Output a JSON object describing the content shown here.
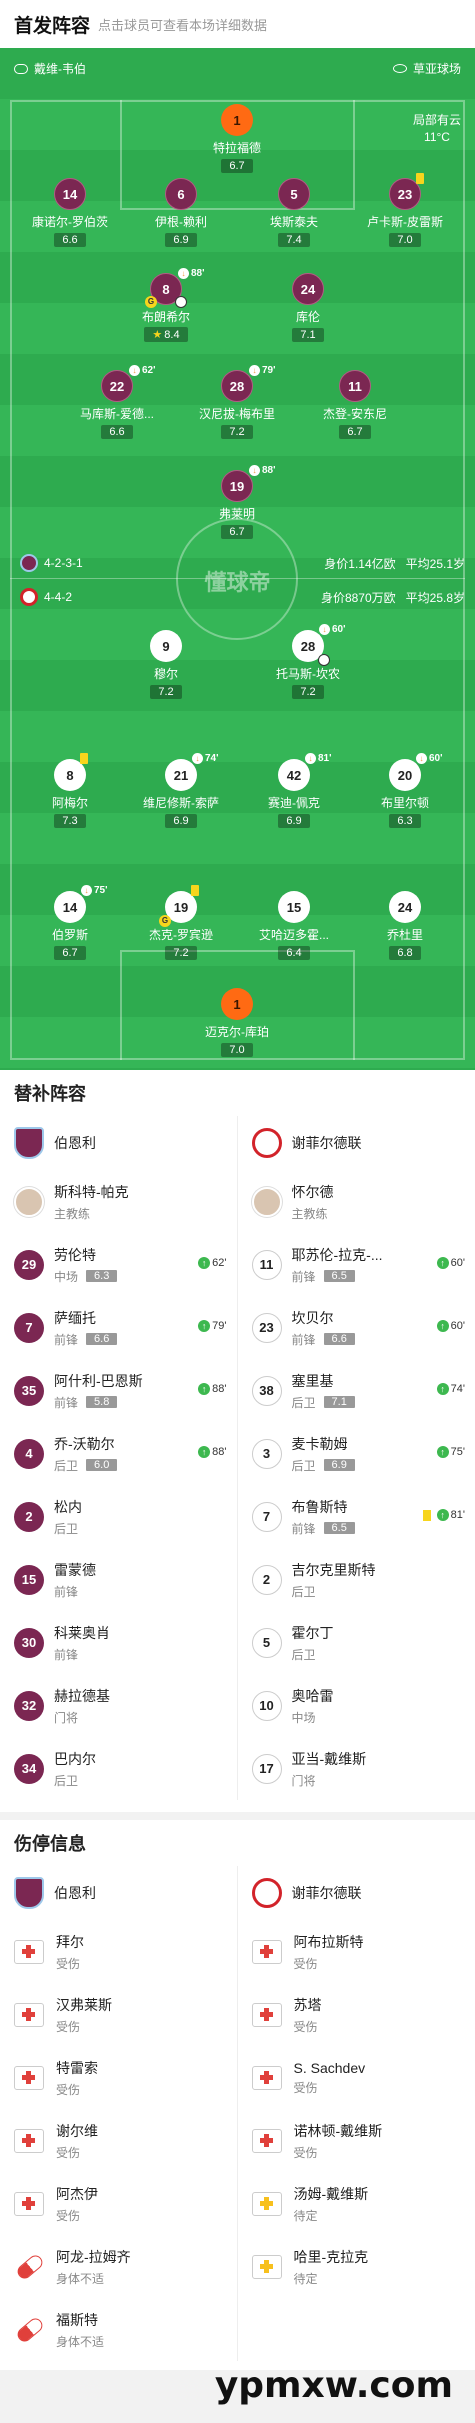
{
  "header": {
    "title": "首发阵容",
    "subtitle": "点击球员可查看本场详细数据"
  },
  "pitch": {
    "venue_left": "戴维-韦伯",
    "venue_right": "草亚球场",
    "weather": "局部有云",
    "temp": "11°C",
    "watermark": "懂球帝",
    "home_formation": "4-2-3-1",
    "home_value": "身价1.14亿欧",
    "home_age": "平均25.1岁",
    "away_formation": "4-4-2",
    "away_value": "身价8870万欧",
    "away_age": "平均25.8岁",
    "home_players": [
      {
        "num": "1",
        "name": "特拉福德",
        "rating": "6.7"
      },
      {
        "num": "14",
        "name": "康诺尔-罗伯茨",
        "rating": "6.6"
      },
      {
        "num": "6",
        "name": "伊根-赖利",
        "rating": "6.9"
      },
      {
        "num": "5",
        "name": "埃斯泰夫",
        "rating": "7.4"
      },
      {
        "num": "23",
        "name": "卢卡斯-皮雷斯",
        "rating": "7.0"
      },
      {
        "num": "8",
        "name": "布朗希尔",
        "rating": "8.4",
        "sub": "88'"
      },
      {
        "num": "24",
        "name": "库伦",
        "rating": "7.1"
      },
      {
        "num": "22",
        "name": "马库斯-爱德...",
        "rating": "6.6",
        "sub": "62'"
      },
      {
        "num": "28",
        "name": "汉尼拔-梅布里",
        "rating": "7.2",
        "sub": "79'"
      },
      {
        "num": "11",
        "name": "杰登-安东尼",
        "rating": "6.7"
      },
      {
        "num": "19",
        "name": "弗莱明",
        "rating": "6.7",
        "sub": "88'"
      }
    ],
    "away_players": [
      {
        "num": "9",
        "name": "穆尔",
        "rating": "7.2"
      },
      {
        "num": "28",
        "name": "托马斯-坎农",
        "rating": "7.2",
        "sub": "60'"
      },
      {
        "num": "8",
        "name": "阿梅尔",
        "rating": "7.3"
      },
      {
        "num": "21",
        "name": "维尼修斯-索萨",
        "rating": "6.9",
        "sub": "74'"
      },
      {
        "num": "42",
        "name": "赛迪-佩克",
        "rating": "6.9",
        "sub": "81'"
      },
      {
        "num": "20",
        "name": "布里尔顿",
        "rating": "6.3",
        "sub": "60'"
      },
      {
        "num": "14",
        "name": "伯罗斯",
        "rating": "6.7",
        "sub": "75'"
      },
      {
        "num": "19",
        "name": "杰克-罗宾逊",
        "rating": "7.2"
      },
      {
        "num": "15",
        "name": "艾哈迈多霍...",
        "rating": "6.4"
      },
      {
        "num": "24",
        "name": "乔杜里",
        "rating": "6.8"
      },
      {
        "num": "1",
        "name": "迈克尔-库珀",
        "rating": "7.0"
      }
    ]
  },
  "subs": {
    "title": "替补阵容",
    "home_team": "伯恩利",
    "away_team": "谢菲尔德联",
    "home": [
      {
        "num": "",
        "name": "斯科特-帕克",
        "pos": "主教练",
        "rating": "",
        "min": ""
      },
      {
        "num": "29",
        "name": "劳伦特",
        "pos": "中场",
        "rating": "6.3",
        "min": "62'"
      },
      {
        "num": "7",
        "name": "萨缅托",
        "pos": "前锋",
        "rating": "6.6",
        "min": "79'"
      },
      {
        "num": "35",
        "name": "阿什利-巴恩斯",
        "pos": "前锋",
        "rating": "5.8",
        "min": "88'"
      },
      {
        "num": "4",
        "name": "乔-沃勒尔",
        "pos": "后卫",
        "rating": "6.0",
        "min": "88'"
      },
      {
        "num": "2",
        "name": "松内",
        "pos": "后卫",
        "rating": "",
        "min": ""
      },
      {
        "num": "15",
        "name": "雷蒙德",
        "pos": "前锋",
        "rating": "",
        "min": ""
      },
      {
        "num": "30",
        "name": "科莱奥肖",
        "pos": "前锋",
        "rating": "",
        "min": ""
      },
      {
        "num": "32",
        "name": "赫拉德基",
        "pos": "门将",
        "rating": "",
        "min": ""
      },
      {
        "num": "34",
        "name": "巴内尔",
        "pos": "后卫",
        "rating": "",
        "min": ""
      }
    ],
    "away": [
      {
        "num": "",
        "name": "怀尔德",
        "pos": "主教练",
        "rating": "",
        "min": ""
      },
      {
        "num": "11",
        "name": "耶苏伦-拉克-...",
        "pos": "前锋",
        "rating": "6.5",
        "min": "60'"
      },
      {
        "num": "23",
        "name": "坎贝尔",
        "pos": "前锋",
        "rating": "6.6",
        "min": "60'"
      },
      {
        "num": "38",
        "name": "塞里基",
        "pos": "后卫",
        "rating": "7.1",
        "min": "74'"
      },
      {
        "num": "3",
        "name": "麦卡勒姆",
        "pos": "后卫",
        "rating": "6.9",
        "min": "75'"
      },
      {
        "num": "7",
        "name": "布鲁斯特",
        "pos": "前锋",
        "rating": "6.5",
        "min": "81'"
      },
      {
        "num": "2",
        "name": "吉尔克里斯特",
        "pos": "后卫",
        "rating": "",
        "min": ""
      },
      {
        "num": "5",
        "name": "霍尔丁",
        "pos": "后卫",
        "rating": "",
        "min": ""
      },
      {
        "num": "10",
        "name": "奥哈雷",
        "pos": "中场",
        "rating": "",
        "min": ""
      },
      {
        "num": "17",
        "name": "亚当-戴维斯",
        "pos": "门将",
        "rating": "",
        "min": ""
      }
    ]
  },
  "injuries": {
    "title": "伤停信息",
    "home_team": "伯恩利",
    "away_team": "谢菲尔德联",
    "home": [
      {
        "name": "拜尔",
        "status": "受伤",
        "icon": "red-cross"
      },
      {
        "name": "汉弗莱斯",
        "status": "受伤",
        "icon": "red-cross"
      },
      {
        "name": "特雷索",
        "status": "受伤",
        "icon": "red-cross"
      },
      {
        "name": "谢尔维",
        "status": "受伤",
        "icon": "red-cross"
      },
      {
        "name": "阿杰伊",
        "status": "受伤",
        "icon": "red-cross"
      },
      {
        "name": "阿龙-拉姆齐",
        "status": "身体不适",
        "icon": "pill"
      },
      {
        "name": "福斯特",
        "status": "身体不适",
        "icon": "pill"
      }
    ],
    "away": [
      {
        "name": "阿布拉斯特",
        "status": "受伤",
        "icon": "red-cross"
      },
      {
        "name": "苏塔",
        "status": "受伤",
        "icon": "red-cross"
      },
      {
        "name": "S. Sachdev",
        "status": "受伤",
        "icon": "red-cross"
      },
      {
        "name": "诺林顿-戴维斯",
        "status": "受伤",
        "icon": "red-cross"
      },
      {
        "name": "汤姆-戴维斯",
        "status": "待定",
        "icon": "yellow-cross"
      },
      {
        "name": "哈里-克拉克",
        "status": "待定",
        "icon": "yellow-cross"
      }
    ]
  },
  "watermark": "ypmxw.com"
}
